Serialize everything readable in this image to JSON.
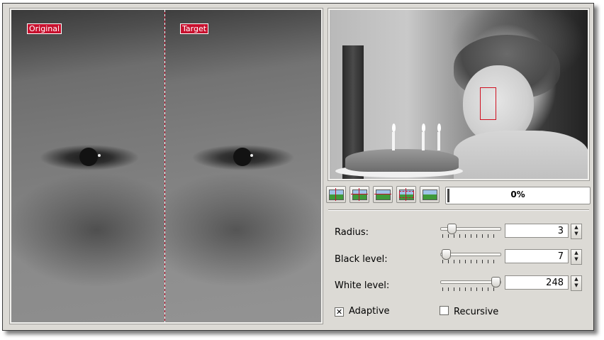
{
  "preview": {
    "original_label": "Original",
    "target_label": "Target"
  },
  "toolbar": {
    "buttons": [
      "orig-duplicate-icon",
      "split-vertical-icon",
      "split-horizontal-icon",
      "split-cross-icon",
      "target-only-icon"
    ],
    "progress_text": "0%",
    "progress_value": 0
  },
  "settings": {
    "radius": {
      "label": "Radius:",
      "value": "3",
      "slider_fraction": 0.15
    },
    "black_level": {
      "label": "Black level:",
      "value": "7",
      "slider_fraction": 0.05
    },
    "white_level": {
      "label": "White level:",
      "value": "248",
      "slider_fraction": 0.93
    }
  },
  "options": {
    "adaptive": {
      "label": "Adaptive",
      "checked": true
    },
    "recursive": {
      "label": "Recursive",
      "checked": false
    }
  },
  "colors": {
    "accent": "#c8102e",
    "window_bg": "#dcdad5"
  }
}
